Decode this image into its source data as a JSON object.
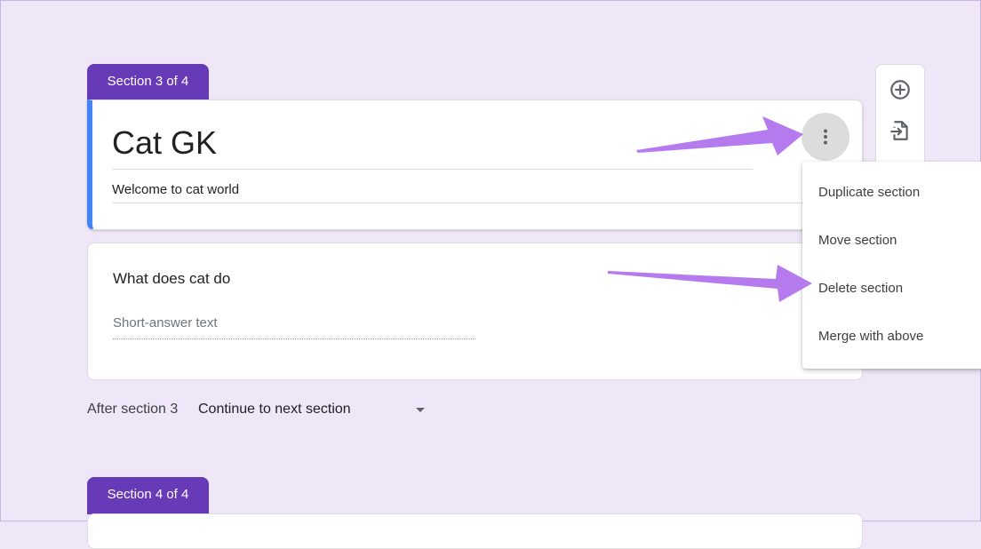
{
  "sections": {
    "current_tab": "Section 3 of 4",
    "next_tab": "Section 4 of 4"
  },
  "title_card": {
    "title": "Cat GK",
    "description": "Welcome to cat world"
  },
  "question": {
    "title": "What does cat do",
    "placeholder": "Short-answer text"
  },
  "after_section": {
    "label": "After section 3",
    "selected": "Continue to next section"
  },
  "section_menu": {
    "items": [
      {
        "label": "Duplicate section"
      },
      {
        "label": "Move section"
      },
      {
        "label": "Delete section"
      },
      {
        "label": "Merge with above"
      }
    ]
  },
  "toolbar": {
    "icons": [
      "add-question-icon",
      "import-questions-icon"
    ]
  },
  "colors": {
    "background": "#efe6f7",
    "section_tab": "#673ab7",
    "title_accent": "#4285f4",
    "annotation_arrow": "#b57bee"
  }
}
